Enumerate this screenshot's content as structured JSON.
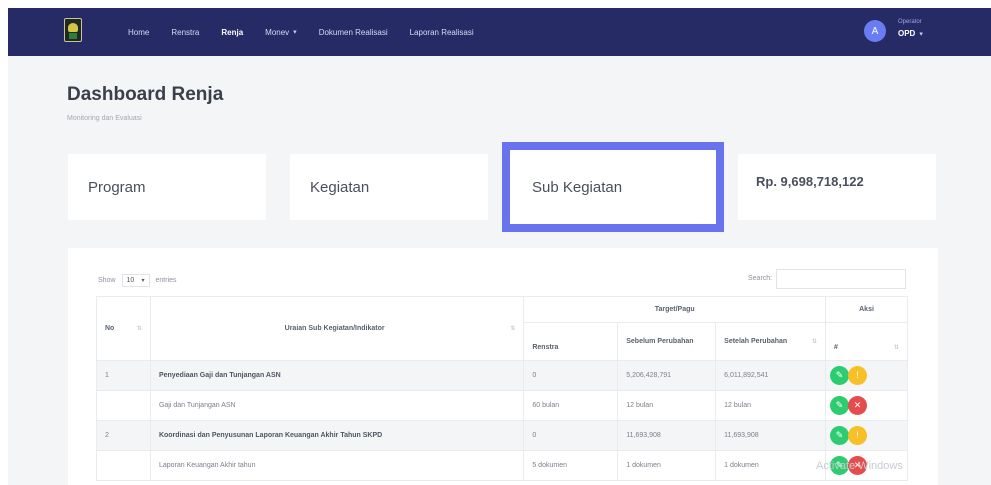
{
  "navbar": {
    "items": [
      "Home",
      "Renstra",
      "Renja",
      "Monev",
      "Dokumen Realisasi",
      "Laporan Realisasi"
    ],
    "active_item": "Renja",
    "user_role": "Operator",
    "user_name": "OPD",
    "avatar_letter": "A"
  },
  "header": {
    "title": "Dashboard Renja",
    "subtitle": "Monitoring dan Evaluasi"
  },
  "cards": {
    "program": "Program",
    "kegiatan": "Kegiatan",
    "sub_kegiatan": "Sub Kegiatan",
    "amount": "Rp. 9,698,718,122"
  },
  "table_controls": {
    "show_label": "Show",
    "show_value": "10",
    "entries_label": "entries",
    "search_label": "Search:"
  },
  "table": {
    "col_no": "No",
    "col_uraian": "Uraian Sub Kegiatan/Indikator",
    "col_target_group": "Target/Pagu",
    "col_renstra": "Renstra",
    "col_sebelum": "Sebelum Perubahan",
    "col_sesudah": "Setelah Perubahan",
    "col_aksi_group": "Aksi",
    "col_aksi": "#",
    "rows": [
      {
        "no": "1",
        "uraian": "Penyediaan Gaji dan Tunjangan ASN",
        "renstra": "0",
        "sebelum": "5,206,428,791",
        "sesudah": "6,011,892,541"
      },
      {
        "no": "",
        "uraian": "Gaji dan Tunjangan ASN",
        "renstra": "60 bulan",
        "sebelum": "12 bulan",
        "sesudah": "12 bulan"
      },
      {
        "no": "2",
        "uraian": "Koordinasi dan Penyusunan Laporan Keuangan Akhir Tahun SKPD",
        "renstra": "0",
        "sebelum": "11,693,908",
        "sesudah": "11,693,908"
      },
      {
        "no": "",
        "uraian": "Laporan Keuangan Akhir tahun",
        "renstra": "5 dokumen",
        "sebelum": "1 dokumen",
        "sesudah": "1 dokumen"
      }
    ]
  },
  "watermark": "Activate Windows",
  "colors": {
    "navbar": "#262b66",
    "highlight_border": "#6a73ee",
    "btn_green": "#2ecc71",
    "btn_yellow": "#f6c026",
    "btn_red": "#e64c4c"
  },
  "icons": {
    "edit": "edit-icon",
    "info": "info-icon",
    "delete": "delete-icon"
  }
}
